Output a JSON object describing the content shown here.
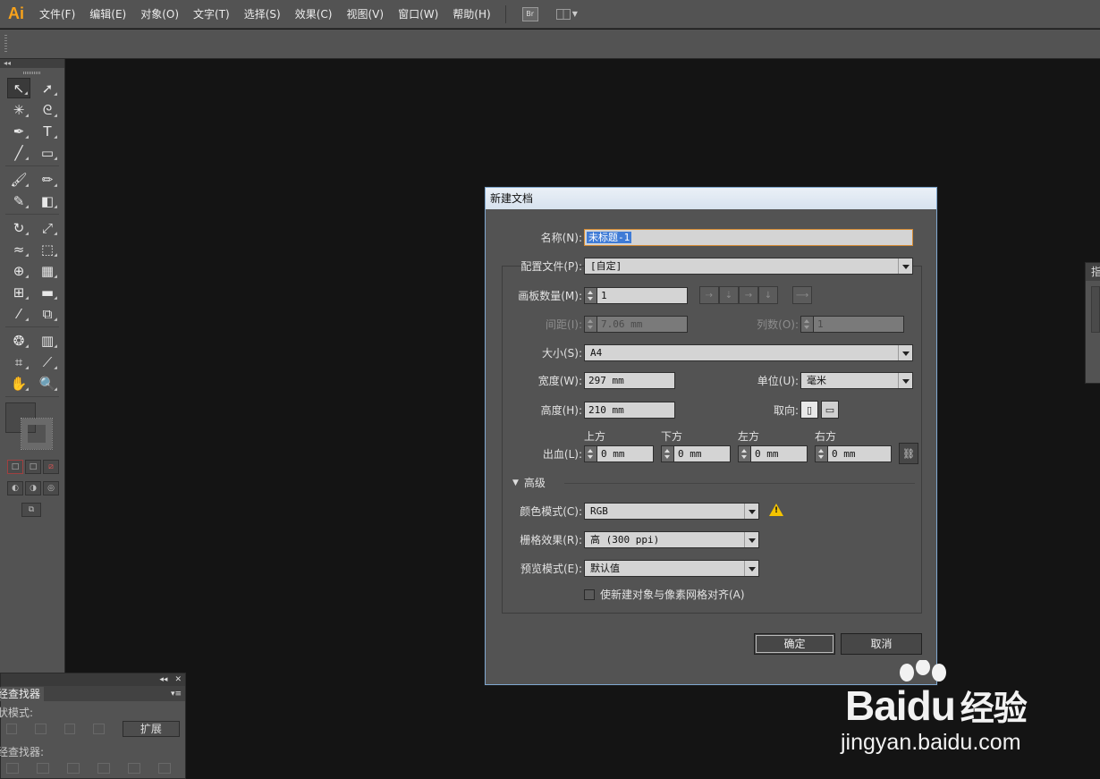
{
  "app": {
    "logo": "Ai"
  },
  "menubar": {
    "items": [
      "文件(F)",
      "编辑(E)",
      "对象(O)",
      "文字(T)",
      "选择(S)",
      "效果(C)",
      "视图(V)",
      "窗口(W)",
      "帮助(H)"
    ],
    "bridge_label": "Br"
  },
  "toolbox": {
    "collapse": "◂◂",
    "tools": [
      [
        "selection-tool",
        "direct-selection-tool"
      ],
      [
        "magic-wand-tool",
        "lasso-tool"
      ],
      [
        "pen-tool",
        "type-tool"
      ],
      [
        "line-segment-tool",
        "rectangle-tool"
      ],
      [
        "paintbrush-tool",
        "pencil-tool"
      ],
      [
        "blob-brush-tool",
        "eraser-tool"
      ],
      [
        "rotate-tool",
        "scale-tool"
      ],
      [
        "warp-tool",
        "free-transform-tool"
      ],
      [
        "shape-builder-tool",
        "perspective-grid-tool"
      ],
      [
        "mesh-tool",
        "gradient-tool"
      ],
      [
        "eyedropper-tool",
        "blend-tool"
      ],
      [
        "symbol-sprayer-tool",
        "column-graph-tool"
      ],
      [
        "artboard-tool",
        "slice-tool"
      ],
      [
        "hand-tool",
        "zoom-tool"
      ]
    ],
    "glyphs": {
      "selection-tool": "↖",
      "direct-selection-tool": "➚",
      "magic-wand-tool": "✳",
      "lasso-tool": "ᘓ",
      "pen-tool": "✒",
      "type-tool": "T",
      "line-segment-tool": "╱",
      "rectangle-tool": "▭",
      "paintbrush-tool": "🖌",
      "pencil-tool": "✏",
      "blob-brush-tool": "✎",
      "eraser-tool": "◧",
      "rotate-tool": "↻",
      "scale-tool": "⤢",
      "warp-tool": "≈",
      "free-transform-tool": "⬚",
      "shape-builder-tool": "⊕",
      "perspective-grid-tool": "▦",
      "mesh-tool": "⊞",
      "gradient-tool": "▬",
      "eyedropper-tool": "⁄",
      "blend-tool": "⧉",
      "symbol-sprayer-tool": "❂",
      "column-graph-tool": "▥",
      "artboard-tool": "⌗",
      "slice-tool": "⟋",
      "hand-tool": "✋",
      "zoom-tool": "🔍"
    }
  },
  "pathfinder": {
    "tab": "经查找器",
    "shape_modes_label": "状模式:",
    "pathfinders_label": "经查找器:",
    "expand_button": "扩展",
    "menu_icon": "▾≡",
    "collapse": "◂◂",
    "close": "✕"
  },
  "right_panel": {
    "tab": "指"
  },
  "dialog": {
    "title": "新建文档",
    "name_label": "名称(N):",
    "name_value": "未标题-1",
    "profile_label": "配置文件(P):",
    "profile_value": "[自定]",
    "artboards_label": "画板数量(M):",
    "artboards_value": "1",
    "spacing_label": "间距(I):",
    "spacing_value": "7.06 mm",
    "columns_label": "列数(O):",
    "columns_value": "1",
    "size_label": "大小(S):",
    "size_value": "A4",
    "width_label": "宽度(W):",
    "width_value": "297 mm",
    "units_label": "单位(U):",
    "units_value": "毫米",
    "height_label": "高度(H):",
    "height_value": "210 mm",
    "orientation_label": "取向:",
    "bleed_label": "出血(L):",
    "bleed": [
      {
        "label": "上方",
        "value": "0 mm"
      },
      {
        "label": "下方",
        "value": "0 mm"
      },
      {
        "label": "左方",
        "value": "0 mm"
      },
      {
        "label": "右方",
        "value": "0 mm"
      }
    ],
    "advanced_label": "高级",
    "color_mode_label": "颜色模式(C):",
    "color_mode_value": "RGB",
    "raster_label": "栅格效果(R):",
    "raster_value": "高 (300 ppi)",
    "preview_label": "预览模式(E):",
    "preview_value": "默认值",
    "align_checkbox_label": "使新建对象与像素网格对齐(A)",
    "align_checked": false,
    "ok_button": "确定",
    "cancel_button": "取消"
  },
  "watermark": {
    "brand": "Bai",
    "brand_du": "du",
    "brand_cn": "经验",
    "url": "jingyan.baidu.com"
  },
  "colors": {
    "ui_panel": "#535353",
    "canvas": "#141414",
    "accent_orange": "#f7a21b",
    "dialog_border": "#7fa7cf",
    "warning": "#f5c400",
    "selection": "#3f7bd6"
  }
}
